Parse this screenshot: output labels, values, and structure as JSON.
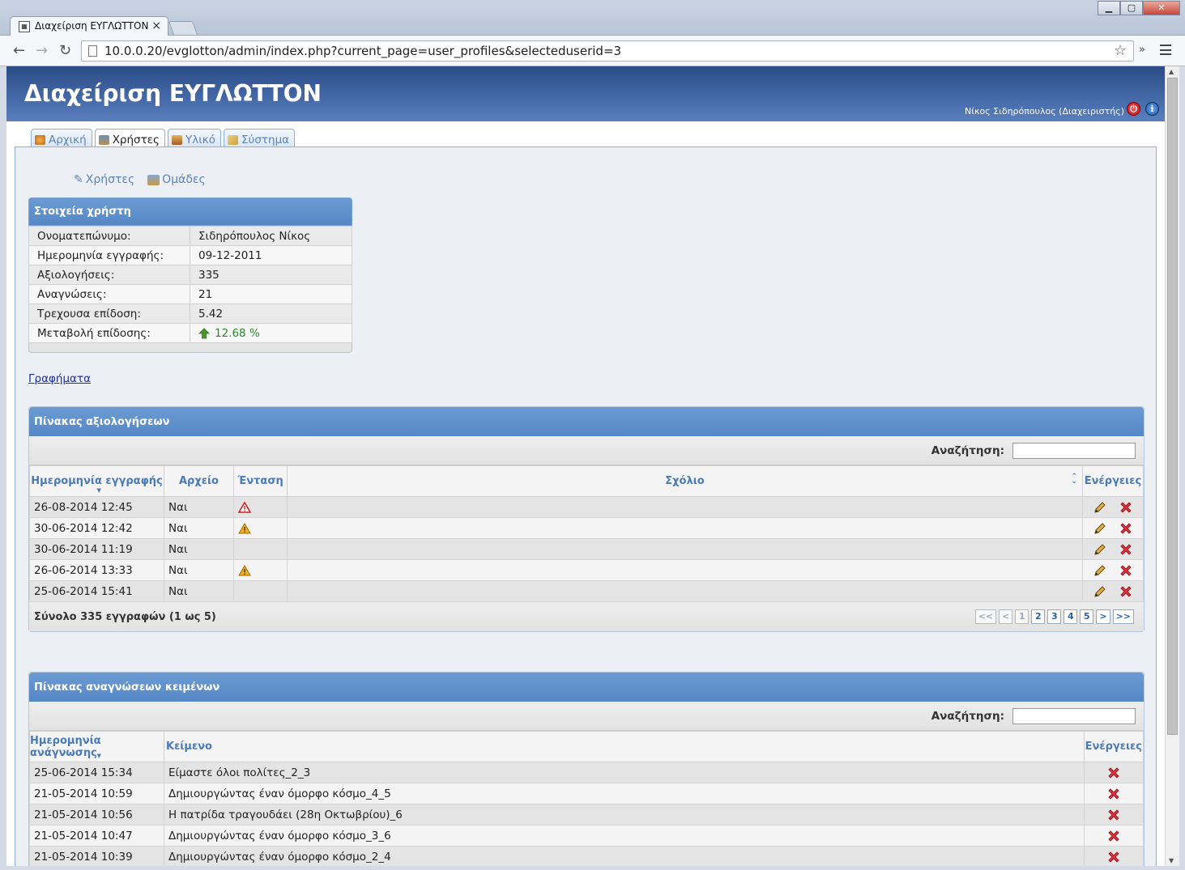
{
  "browser": {
    "tab_title": "Διαχείριση ΕΥΓΛΩΤΤΟΝ",
    "url": "10.0.0.20/evglotton/admin/index.php?current_page=user_profiles&selecteduserid=3"
  },
  "header": {
    "title": "Διαχείριση ΕΥΓΛΩΤΤΟΝ",
    "user": "Νίκος Σιδηρόπουλος (Διαχειριστής)"
  },
  "tabs": [
    {
      "label": "Αρχική"
    },
    {
      "label": "Χρήστες"
    },
    {
      "label": "Υλικό"
    },
    {
      "label": "Σύστημα"
    }
  ],
  "subnav": {
    "users": "Χρήστες",
    "groups": "Ομάδες"
  },
  "user_panel": {
    "title": "Στοιχεία χρήστη",
    "rows": [
      {
        "label": "Ονοματεπώνυμο:",
        "value": "Σιδηρόπουλος Νίκος"
      },
      {
        "label": "Ημερομηνία εγγραφής:",
        "value": "09-12-2011"
      },
      {
        "label": "Αξιολογήσεις:",
        "value": "335"
      },
      {
        "label": "Αναγνώσεις:",
        "value": "21"
      },
      {
        "label": "Τρεχουσα επίδοση:",
        "value": "5.42"
      },
      {
        "label": "Μεταβολή επίδοσης:",
        "value": "12.68 %"
      }
    ]
  },
  "graphs_link": "Γραφήματα",
  "evaluations": {
    "title": "Πίνακας αξιολογήσεων",
    "search_label": "Αναζήτηση:",
    "columns": [
      "Ημερομηνία εγγραφής",
      "Αρχείο",
      "Ένταση",
      "Σχόλιο",
      "Ενέργειες"
    ],
    "rows": [
      {
        "date": "26-08-2014 12:45",
        "file": "Ναι",
        "intensity": "error-outline",
        "comment": ""
      },
      {
        "date": "30-06-2014 12:42",
        "file": "Ναι",
        "intensity": "warning",
        "comment": ""
      },
      {
        "date": "30-06-2014 11:19",
        "file": "Ναι",
        "intensity": "",
        "comment": ""
      },
      {
        "date": "26-06-2014 13:33",
        "file": "Ναι",
        "intensity": "warning",
        "comment": ""
      },
      {
        "date": "25-06-2014 15:41",
        "file": "Ναι",
        "intensity": "",
        "comment": ""
      }
    ],
    "footer": "Σύνολο 335 εγγραφών (1 ως 5)",
    "pager": [
      "<<",
      "<",
      "1",
      "2",
      "3",
      "4",
      "5",
      ">",
      ">>"
    ]
  },
  "readings": {
    "title": "Πίνακας αναγνώσεων κειμένων",
    "search_label": "Αναζήτηση:",
    "columns": [
      "Ημερομηνία ανάγνωσης",
      "Κείμενο",
      "Ενέργειες"
    ],
    "rows": [
      {
        "date": "25-06-2014 15:34",
        "text": "Είμαστε όλοι πολίτες_2_3"
      },
      {
        "date": "21-05-2014 10:59",
        "text": "Δημιουργώντας έναν όμορφο κόσμο_4_5"
      },
      {
        "date": "21-05-2014 10:56",
        "text": "Η πατρίδα τραγουδάει (28η Οκτωβρίου)_6"
      },
      {
        "date": "21-05-2014 10:47",
        "text": "Δημιουργώντας έναν όμορφο κόσμο_3_6"
      },
      {
        "date": "21-05-2014 10:39",
        "text": "Δημιουργώντας έναν όμορφο κόσμο_2_4"
      }
    ]
  },
  "colors": {
    "header_dark": "#2b4c86",
    "panel_blue": "#5588c6",
    "link_blue": "#5a84b8",
    "green": "#2a8a2a"
  }
}
